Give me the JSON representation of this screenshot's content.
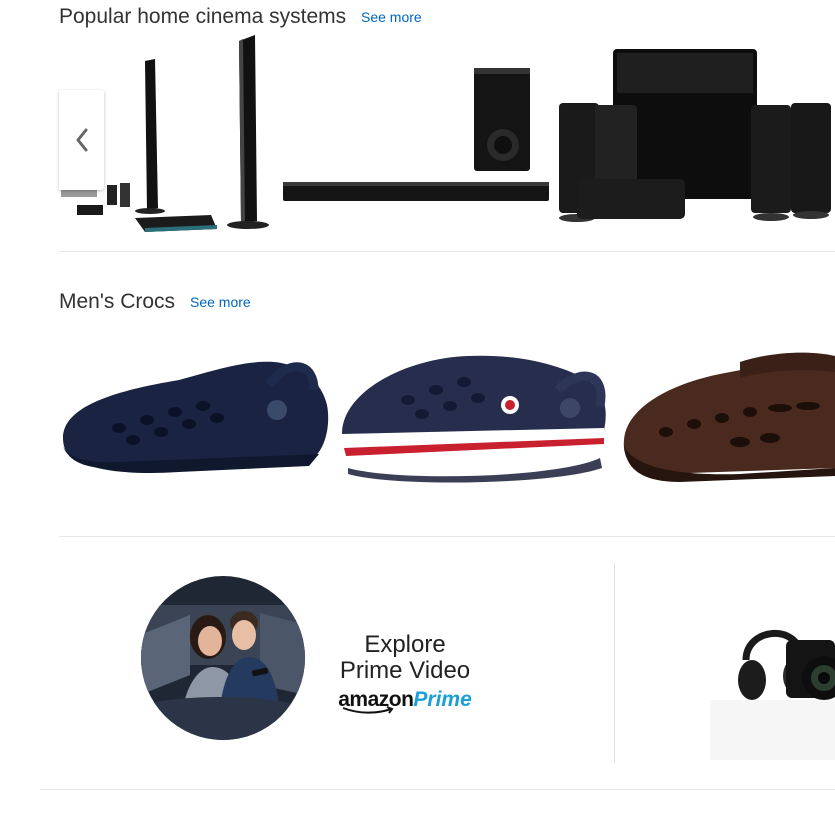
{
  "cinema_section": {
    "title": "Popular home cinema systems",
    "see_more": "See more",
    "products": [
      {
        "name": "tower speaker system with subwoofer and receiver"
      },
      {
        "name": "soundbar with wireless subwoofer"
      },
      {
        "name": "black satellite speaker set with subwoofer"
      }
    ]
  },
  "crocs_section": {
    "title": "Men's Crocs",
    "see_more": "See more",
    "products": [
      {
        "name": "navy classic clog"
      },
      {
        "name": "navy crocband clog with red stripe"
      },
      {
        "name": "brown clog"
      }
    ]
  },
  "promo": {
    "line1": "Explore",
    "line2": "Prime Video",
    "logo_amazon": "amazon",
    "logo_prime": "Prime"
  },
  "colors": {
    "link": "#0066c0",
    "prime_blue": "#1aa0d8",
    "divider": "#e7e7e7"
  }
}
